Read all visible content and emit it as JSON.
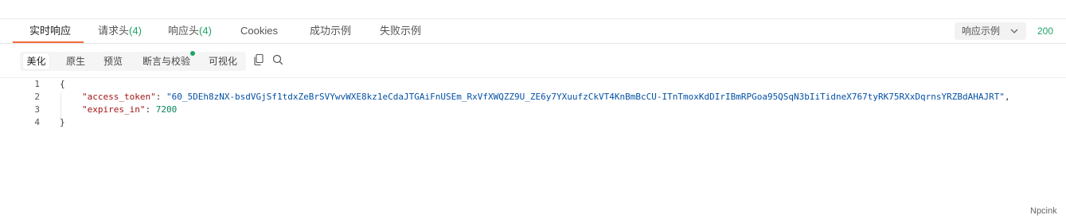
{
  "tabs": [
    {
      "label": "实时响应"
    },
    {
      "label": "请求头",
      "count": "(4)"
    },
    {
      "label": "响应头",
      "count": "(4)"
    },
    {
      "label": "Cookies"
    },
    {
      "label": "成功示例"
    },
    {
      "label": "失败示例"
    }
  ],
  "example_select": {
    "label": "响应示例",
    "icon": "chevron-down-icon"
  },
  "status_code": "200",
  "subtabs": [
    {
      "label": "美化"
    },
    {
      "label": "原生"
    },
    {
      "label": "预览"
    },
    {
      "label": "断言与校验"
    },
    {
      "label": "可视化"
    }
  ],
  "toolbar_icons": [
    "copy-icon",
    "search-icon"
  ],
  "colors": {
    "accent": "#f26b3a",
    "success": "#21a366",
    "key": "#a31515",
    "string": "#0451a5",
    "number": "#098658"
  },
  "code": {
    "line_numbers": [
      "1",
      "2",
      "3",
      "4"
    ],
    "open_brace": "{",
    "close_brace": "}",
    "access_token_key": "\"access_token\"",
    "access_token_value": "\"60_5DEh8zNX-bsdVGjSf1tdxZeBrSVYwvWXE8kz1eCdaJTGAiFnUSEm_RxVfXWQZZ9U_ZE6y7YXuufzCkVT4KnBmBcCU-ITnTmoxKdDIrIBmRPGoa95QSqN3bIiTidneX767tyRK75RXxDqrnsYRZBdAHAJRT\"",
    "expires_in_key": "\"expires_in\"",
    "expires_in_value": "7200",
    "colon": ": ",
    "comma": ","
  },
  "watermark": "Npcink"
}
